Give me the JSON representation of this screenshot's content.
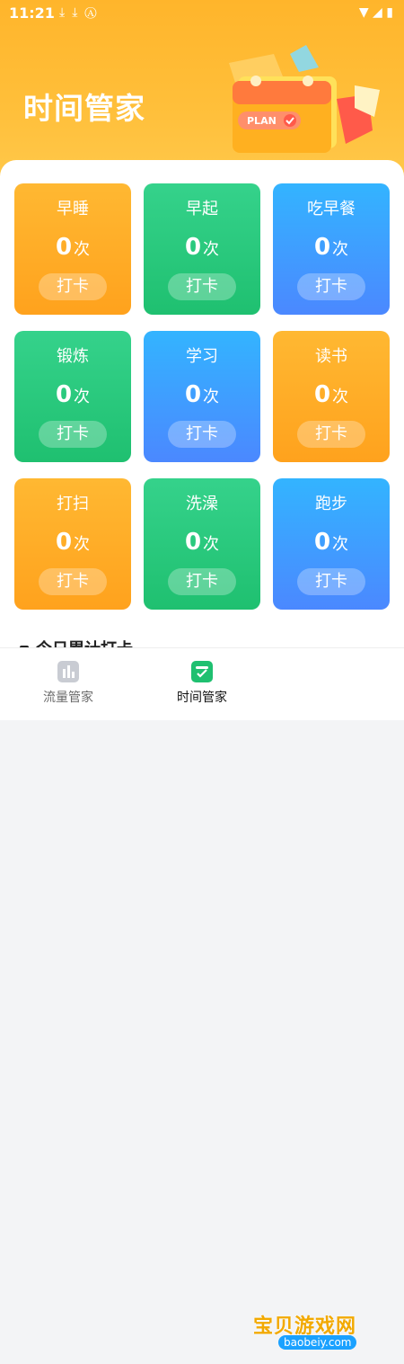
{
  "status_bar": {
    "time": "11:21",
    "left_icons": [
      "download-icon",
      "download-icon",
      "a-icon"
    ],
    "right_icons": [
      "wifi-icon",
      "signal-icon",
      "battery-icon"
    ]
  },
  "header": {
    "title": "时间管家",
    "plan_label": "PLAN"
  },
  "cards": [
    {
      "title": "早睡",
      "count": "0",
      "unit": "次",
      "button": "打卡",
      "color": "orange"
    },
    {
      "title": "早起",
      "count": "0",
      "unit": "次",
      "button": "打卡",
      "color": "green"
    },
    {
      "title": "吃早餐",
      "count": "0",
      "unit": "次",
      "button": "打卡",
      "color": "blue"
    },
    {
      "title": "锻炼",
      "count": "0",
      "unit": "次",
      "button": "打卡",
      "color": "green"
    },
    {
      "title": "学习",
      "count": "0",
      "unit": "次",
      "button": "打卡",
      "color": "blue"
    },
    {
      "title": "读书",
      "count": "0",
      "unit": "次",
      "button": "打卡",
      "color": "orange"
    },
    {
      "title": "打扫",
      "count": "0",
      "unit": "次",
      "button": "打卡",
      "color": "orange"
    },
    {
      "title": "洗澡",
      "count": "0",
      "unit": "次",
      "button": "打卡",
      "color": "green"
    },
    {
      "title": "跑步",
      "count": "0",
      "unit": "次",
      "button": "打卡",
      "color": "blue"
    }
  ],
  "section_peek": {
    "text": "今日累计打卡"
  },
  "tabs": [
    {
      "label": "流量管家",
      "icon": "chart-icon",
      "active": false
    },
    {
      "label": "时间管家",
      "icon": "calendar-check-icon",
      "active": true
    }
  ],
  "watermark": {
    "text": "宝贝游戏网",
    "url": "baobeiy.com"
  },
  "colors": {
    "header": "#ffb52b",
    "orange": "#ffa21d",
    "green": "#1fc070",
    "blue": "#4b88ff",
    "tab_active": "#1fc070"
  }
}
